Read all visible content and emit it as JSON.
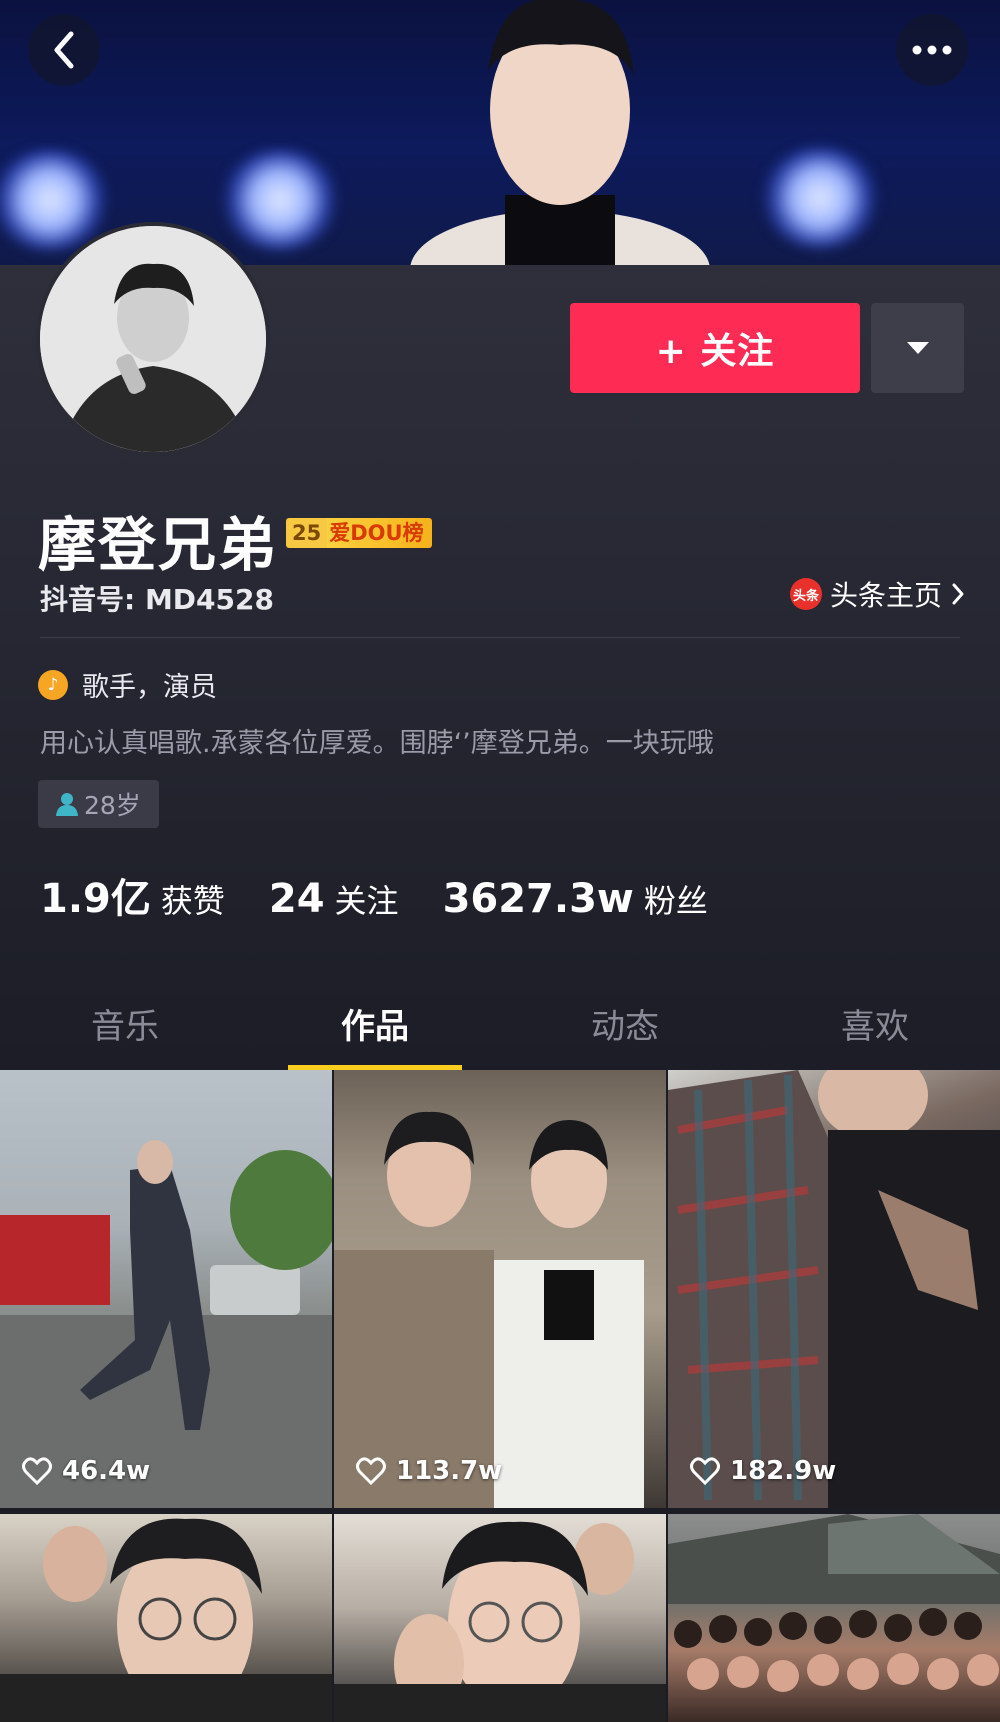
{
  "header": {
    "back_icon": "back-arrow-icon",
    "more_icon": "more-dots-icon"
  },
  "profile": {
    "name": "摩登兄弟",
    "rank_badge": {
      "number": "25",
      "text": "爱DOU榜"
    },
    "douyin_id": "抖音号: MD4528",
    "toutiao_link": "头条主页",
    "toutiao_icon_text": "头条",
    "verification": "歌手，演员",
    "bio": "用心认真唱歌.承蒙各位厚爱。围脖‘’摩登兄弟。一块玩哦",
    "age_tag": "28岁",
    "follow_button": "+ 关注"
  },
  "stats": [
    {
      "num": "1.9亿",
      "label": "获赞"
    },
    {
      "num": "24",
      "label": "关注"
    },
    {
      "num": "3627.3w",
      "label": "粉丝"
    }
  ],
  "tabs": [
    {
      "label": "音乐",
      "active": false
    },
    {
      "label": "作品",
      "active": true
    },
    {
      "label": "动态",
      "active": false
    },
    {
      "label": "喜欢",
      "active": false
    }
  ],
  "videos": [
    {
      "likes": "46.4w"
    },
    {
      "likes": "113.7w"
    },
    {
      "likes": "182.9w"
    },
    {
      "likes": ""
    },
    {
      "likes": ""
    },
    {
      "likes": ""
    }
  ],
  "colors": {
    "follow_button": "#fe2c55",
    "tab_indicator": "#facd1e",
    "background": "#1b1c24"
  }
}
